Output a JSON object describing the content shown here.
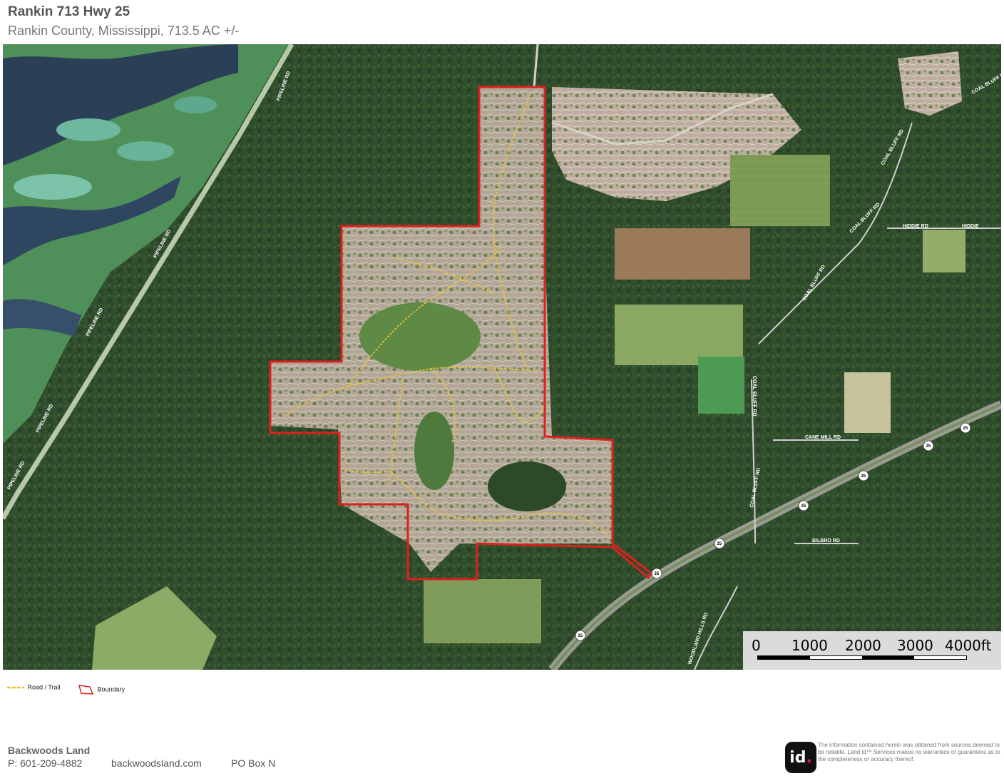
{
  "header": {
    "title": "Rankin 713 Hwy 25",
    "subtitle": "Rankin County, Mississippi, 713.5 AC +/-"
  },
  "map": {
    "road_labels": [
      "PIPELINE RD",
      "PIPELINE RD",
      "PIPELINE RD",
      "COAL BLUFF RD",
      "COAL BLUFF RD",
      "COAL BLUFF RD",
      "COAL BLUFF RD",
      "HIDDIE RD",
      "HIDDIE",
      "CANE MILL RD",
      "BILBRO RD",
      "COAL BLUFF RD",
      "WOODLAND HILLS RD",
      "PIPELINE RD",
      "PIPELINE RD",
      "COAL BLUFF RD"
    ],
    "highway_shields": [
      "25",
      "25",
      "25",
      "25",
      "25",
      "25",
      "25"
    ],
    "scale": {
      "labels": [
        "0",
        "1000",
        "2000",
        "3000",
        "4000ft"
      ]
    },
    "colors": {
      "boundary": "#e0201e",
      "trail": "#e7c437",
      "forest": "#2d4a29",
      "clearing": "#c9b7a6",
      "water": "#2b3f57"
    }
  },
  "legend": {
    "trail_label": "Road / Trail",
    "boundary_label": "Boundary"
  },
  "footer": {
    "company": "Backwoods Land",
    "phone": "P: 601-209-4882",
    "website": "backwoodsland.com",
    "po_box": "PO Box N",
    "logo_text": "id",
    "logo_dot": ".",
    "disclaimer": "The information contained herein was obtained from sources deemed to be reliable. Land id™ Services makes no warranties or guarantees as to the completeness or accuracy thereof."
  }
}
